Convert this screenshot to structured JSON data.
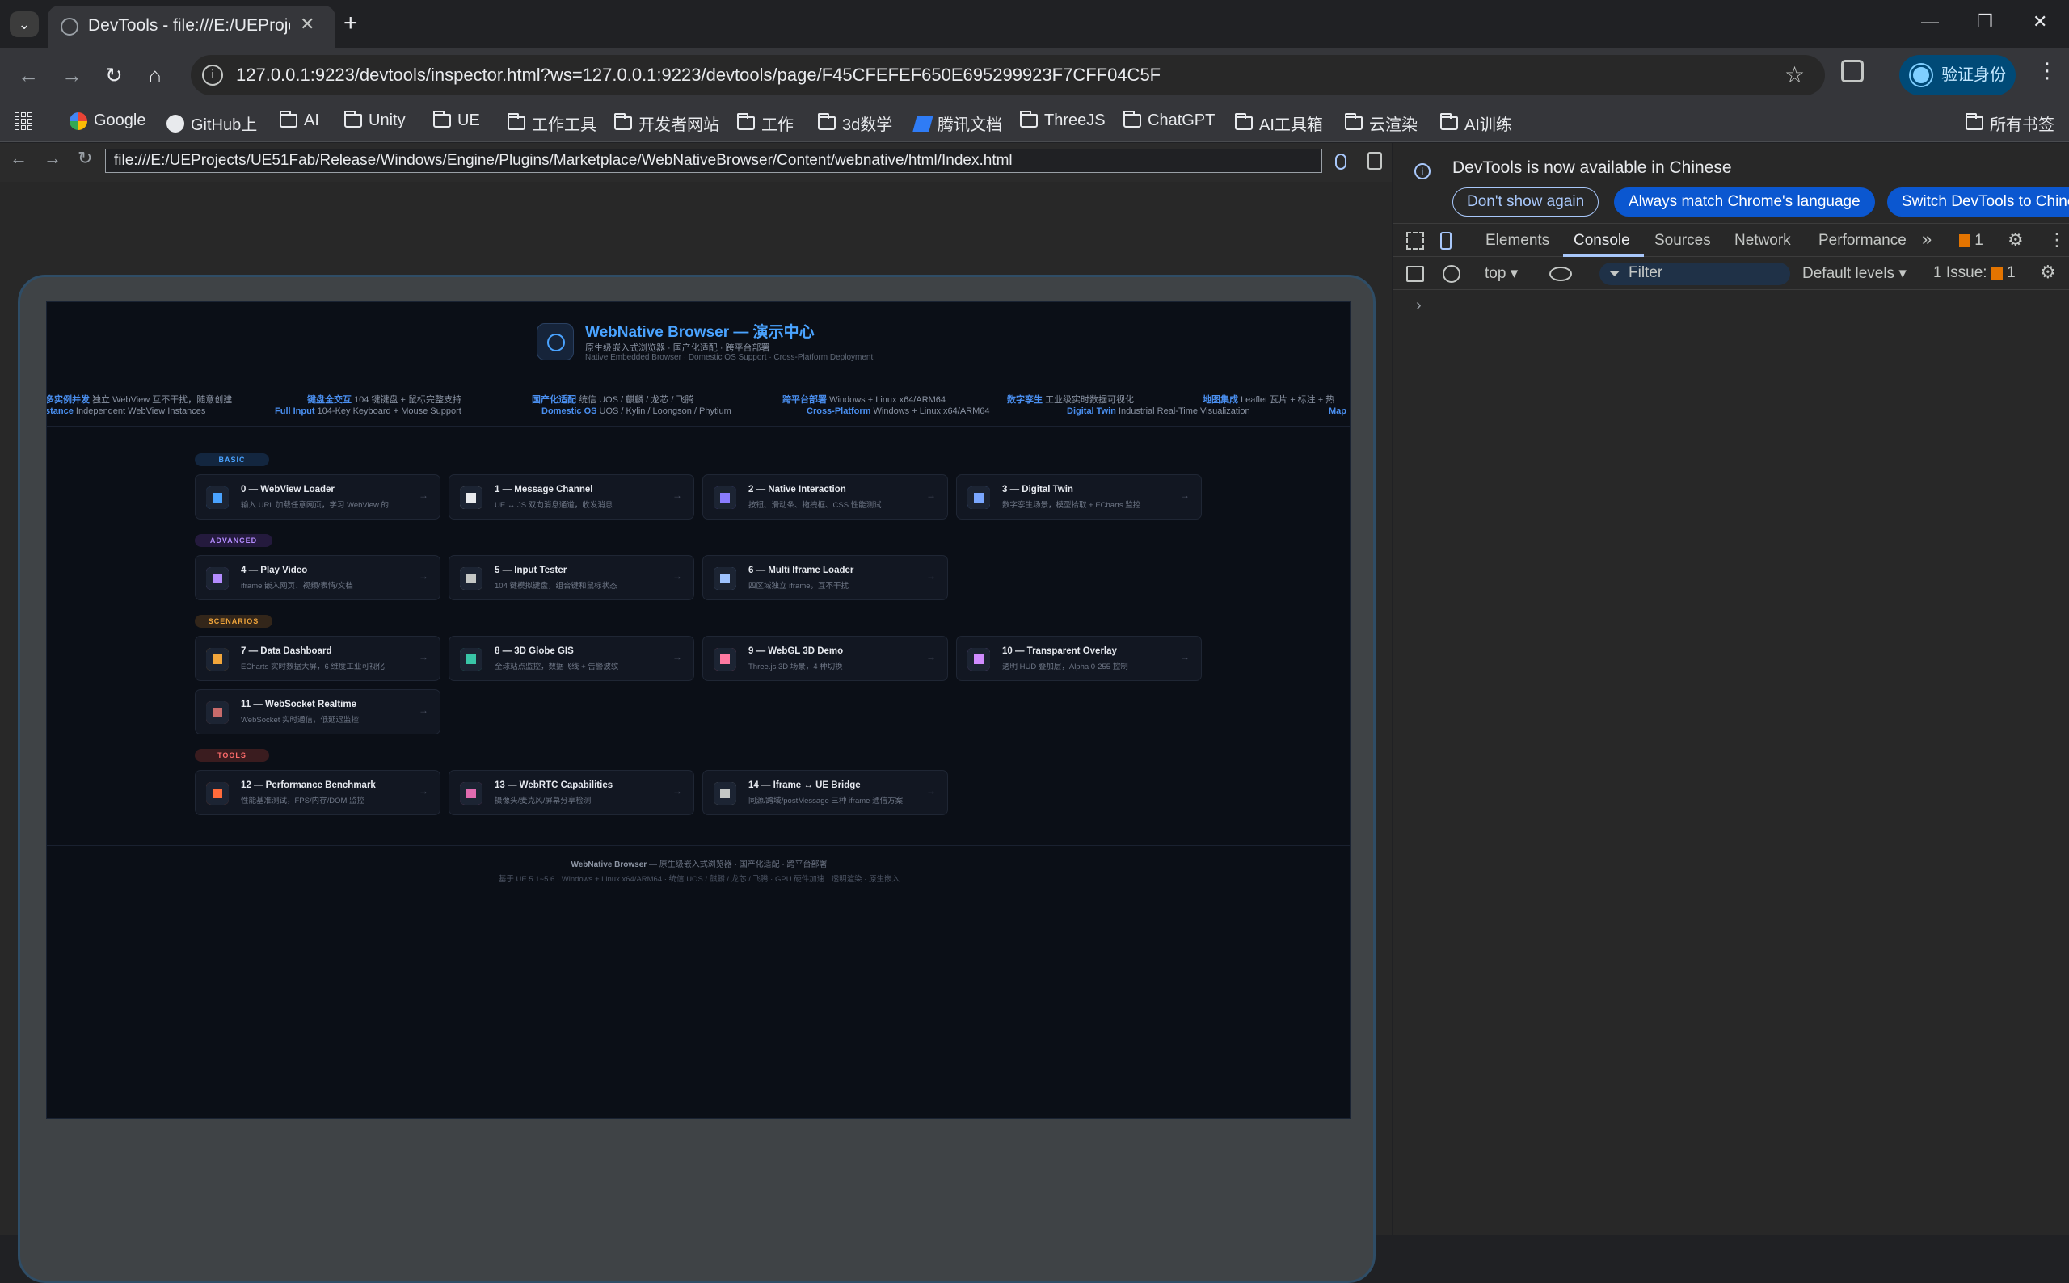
{
  "tab": {
    "title": "DevTools - file:///E:/UEProjects",
    "close": "✕",
    "new": "+",
    "search_glyph": "⌄"
  },
  "window": {
    "min": "—",
    "restore": "❐",
    "close": "✕"
  },
  "nav": {
    "back": "←",
    "forward": "→",
    "reload": "↻",
    "home": "⌂"
  },
  "omnibox": {
    "url": "127.0.0.1:9223/devtools/inspector.html?ws=127.0.0.1:9223/devtools/page/F45CFEFEF650E695299923F7CFF04C5F",
    "info": "i",
    "star": "☆"
  },
  "profile": {
    "label": "验证身份"
  },
  "menu_glyph": "⋮",
  "bookmarks": {
    "items": [
      "Google",
      "GitHub上",
      "AI",
      "Unity",
      "UE",
      "工作工具",
      "开发者网站",
      "工作",
      "3d数学",
      "腾讯文档",
      "ThreeJS",
      "ChatGPT",
      "AI工具箱",
      "云渲染",
      "AI训练"
    ],
    "all": "所有书签"
  },
  "inner": {
    "url": "file:///E:/UEProjects/UE51Fab/Release/Windows/Engine/Plugins/Marketplace/WebNativeBrowser/Content/webnative/html/Index.html"
  },
  "app": {
    "title": "WebNative Browser — 演示中心",
    "subtitle_cn": "原生级嵌入式浏览器 · 国产化适配 · 跨平台部署",
    "subtitle_en": "Native Embedded Browser · Domestic OS Support · Cross-Platform Deployment",
    "ticker": [
      {
        "k1": "多实例并发",
        "v1": "独立 WebView 互不干扰，随意创建",
        "k2": "stance",
        "v2": "Independent WebView Instances"
      },
      {
        "k1": "键盘全交互",
        "v1": "104 键键盘 + 鼠标完整支持",
        "k2": "Full Input",
        "v2": "104-Key Keyboard + Mouse Support"
      },
      {
        "k1": "国产化适配",
        "v1": "统信 UOS / 麒麟 / 龙芯 / 飞腾",
        "k2": "Domestic OS",
        "v2": "UOS / Kylin / Loongson / Phytium"
      },
      {
        "k1": "跨平台部署",
        "v1": "Windows + Linux x64/ARM64",
        "k2": "Cross-Platform",
        "v2": "Windows + Linux x64/ARM64"
      },
      {
        "k1": "数字孪生",
        "v1": "工业级实时数据可视化",
        "k2": "Digital Twin",
        "v2": "Industrial Real-Time Visualization"
      },
      {
        "k1": "地图集成",
        "v1": "Leaflet 瓦片 + 标注 + 热",
        "k2": "Map",
        "v2": ""
      }
    ],
    "sections": [
      {
        "label": "BASIC",
        "color": "#4aa3ff",
        "bg": "#13263f"
      },
      {
        "label": "ADVANCED",
        "color": "#b48cff",
        "bg": "#241a3d"
      },
      {
        "label": "SCENARIOS",
        "color": "#f2a63b",
        "bg": "#33261a"
      },
      {
        "label": "TOOLS",
        "color": "#ff6b6b",
        "bg": "#3a1c1f"
      }
    ],
    "cards": [
      {
        "t": "0 — WebView Loader",
        "d": "输入 URL 加载任意网页，学习 WebView 的...",
        "c": "#4aa3ff"
      },
      {
        "t": "1 — Message Channel",
        "d": "UE ↔ JS 双向消息通道，收发消息",
        "c": "#e8eaed"
      },
      {
        "t": "2 — Native Interaction",
        "d": "按钮、滑动条、拖拽框、CSS 性能测试",
        "c": "#8a7cff"
      },
      {
        "t": "3 — Digital Twin",
        "d": "数字孪生场景，模型拾取 + ECharts 监控",
        "c": "#7aa7ff"
      },
      {
        "t": "4 — Play Video",
        "d": "iframe 嵌入网页、视频/表情/文档",
        "c": "#b48cff"
      },
      {
        "t": "5 — Input Tester",
        "d": "104 键模拟键盘，组合键和鼠标状态",
        "c": "#c4c7c5"
      },
      {
        "t": "6 — Multi Iframe Loader",
        "d": "四区域独立 iframe，互不干扰",
        "c": "#9ec3ff"
      },
      {
        "t": "7 — Data Dashboard",
        "d": "ECharts 实时数据大屏，6 维度工业可视化",
        "c": "#f2a63b"
      },
      {
        "t": "8 — 3D Globe GIS",
        "d": "全球站点监控，数据飞线 + 告警波纹",
        "c": "#39c5a7"
      },
      {
        "t": "9 — WebGL 3D Demo",
        "d": "Three.js 3D 场景，4 种切换",
        "c": "#ff7aa2"
      },
      {
        "t": "10 — Transparent Overlay",
        "d": "透明 HUD 叠加层，Alpha 0-255 控制",
        "c": "#d08cff"
      },
      {
        "t": "11 — WebSocket Realtime",
        "d": "WebSocket 实时通信，低延迟监控",
        "c": "#c76b6b"
      },
      {
        "t": "12 — Performance Benchmark",
        "d": "性能基准测试，FPS/内存/DOM 监控",
        "c": "#ff6b3b"
      },
      {
        "t": "13 — WebRTC Capabilities",
        "d": "摄像头/麦克风/屏幕分享检测",
        "c": "#e06bb0"
      },
      {
        "t": "14 — Iframe ↔ UE Bridge",
        "d": "同源/跨域/postMessage 三种 iframe 通信方案",
        "c": "#c4c7c5"
      }
    ],
    "arrow": "→",
    "footer1_b": "WebNative Browser",
    "footer1": " — 原生级嵌入式浏览器 · 国产化适配 · 跨平台部署",
    "footer2": "基于 UE 5.1~5.6 · Windows + Linux x64/ARM64 · 统信 UOS / 麒麟 / 龙芯 / 飞腾 · GPU 硬件加速 · 透明渲染 · 原生嵌入"
  },
  "devtools": {
    "info": "DevTools is now available in Chinese",
    "btn1": "Don't show again",
    "btn2": "Always match Chrome's language",
    "btn3": "Switch DevTools to Chinese",
    "tabs": [
      "Elements",
      "Console",
      "Sources",
      "Network",
      "Performance"
    ],
    "more": "»",
    "issues_count": "1",
    "context": "top ▾",
    "filter": "Filter",
    "levels": "Default levels ▾",
    "issue_label": "1 Issue:",
    "issue_num": "1",
    "prompt": "›"
  }
}
